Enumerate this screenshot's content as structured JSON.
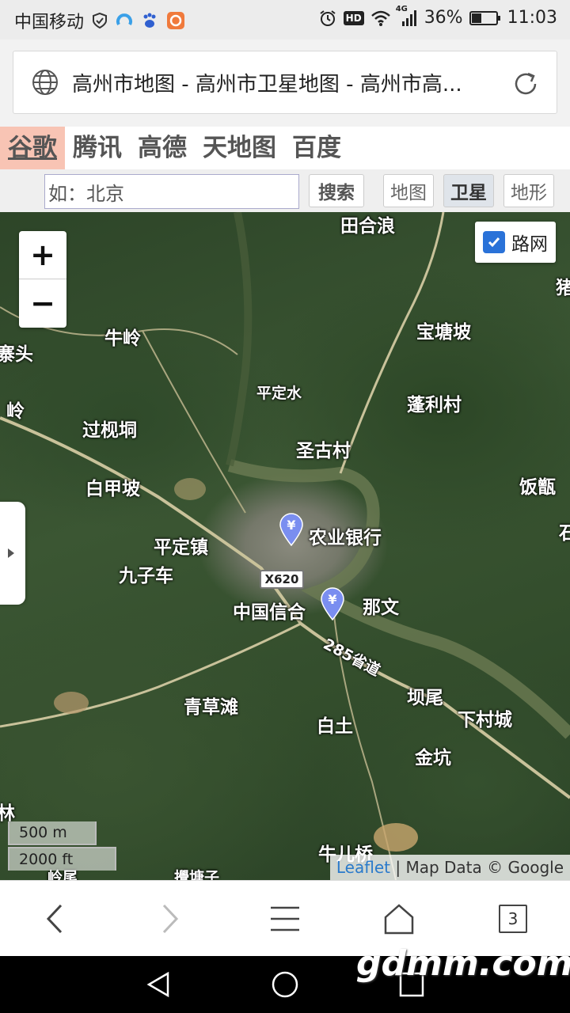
{
  "status_bar": {
    "carrier": "中国移动",
    "battery": "36%",
    "time": "11:03",
    "network": "4G",
    "hd": "HD"
  },
  "url_bar": {
    "title": "高州市地图 - 高州市卫星地图 - 高州市高..."
  },
  "providers": [
    {
      "label": "谷歌",
      "active": true
    },
    {
      "label": "腾讯",
      "active": false
    },
    {
      "label": "高德",
      "active": false
    },
    {
      "label": "天地图",
      "active": false
    },
    {
      "label": "百度",
      "active": false
    }
  ],
  "search": {
    "value": "如：北京",
    "search_label": "搜索",
    "map_label": "地图",
    "satellite_label": "卫星",
    "terrain_label": "地形"
  },
  "map": {
    "zoom_in": "+",
    "zoom_out": "−",
    "roadnet_label": "路网",
    "road_shield": "X620",
    "scale_metric": "500 m",
    "scale_imperial": "2000 ft",
    "attribution_link": "Leaflet",
    "attribution_text": " | Map Data © Google",
    "places": {
      "tianhelang": "田合浪",
      "zhu": "猪",
      "niuling": "牛岭",
      "baotangpo": "宝塘坡",
      "zhaitou": "寨头",
      "pingdingshui": "平定水",
      "fenglicun": "蓬利村",
      "ling": "岭",
      "guojidong": "过枧垌",
      "shenggucun": "圣古村",
      "baijiapo": "白甲坡",
      "fanjian": "饭甑",
      "shi": "石",
      "nongyeyinhang": "农业银行",
      "pingdingzhen": "平定镇",
      "jiuziche": "九子车",
      "zhongguoxinhe": "中国信合",
      "nawen": "那文",
      "route285": "285省道",
      "bawei": "坝尾",
      "qingcaotan": "青草滩",
      "xiacuncheng": "下村城",
      "baitu": "白土",
      "jinkeng": "金坑",
      "lin": "林",
      "niuerqiao": "牛儿桥",
      "lingwei": "岭尾",
      "litangzi": "攪塘子"
    }
  },
  "bottom_bar": {
    "tab_count": "3"
  },
  "watermark": "gdmm.com"
}
